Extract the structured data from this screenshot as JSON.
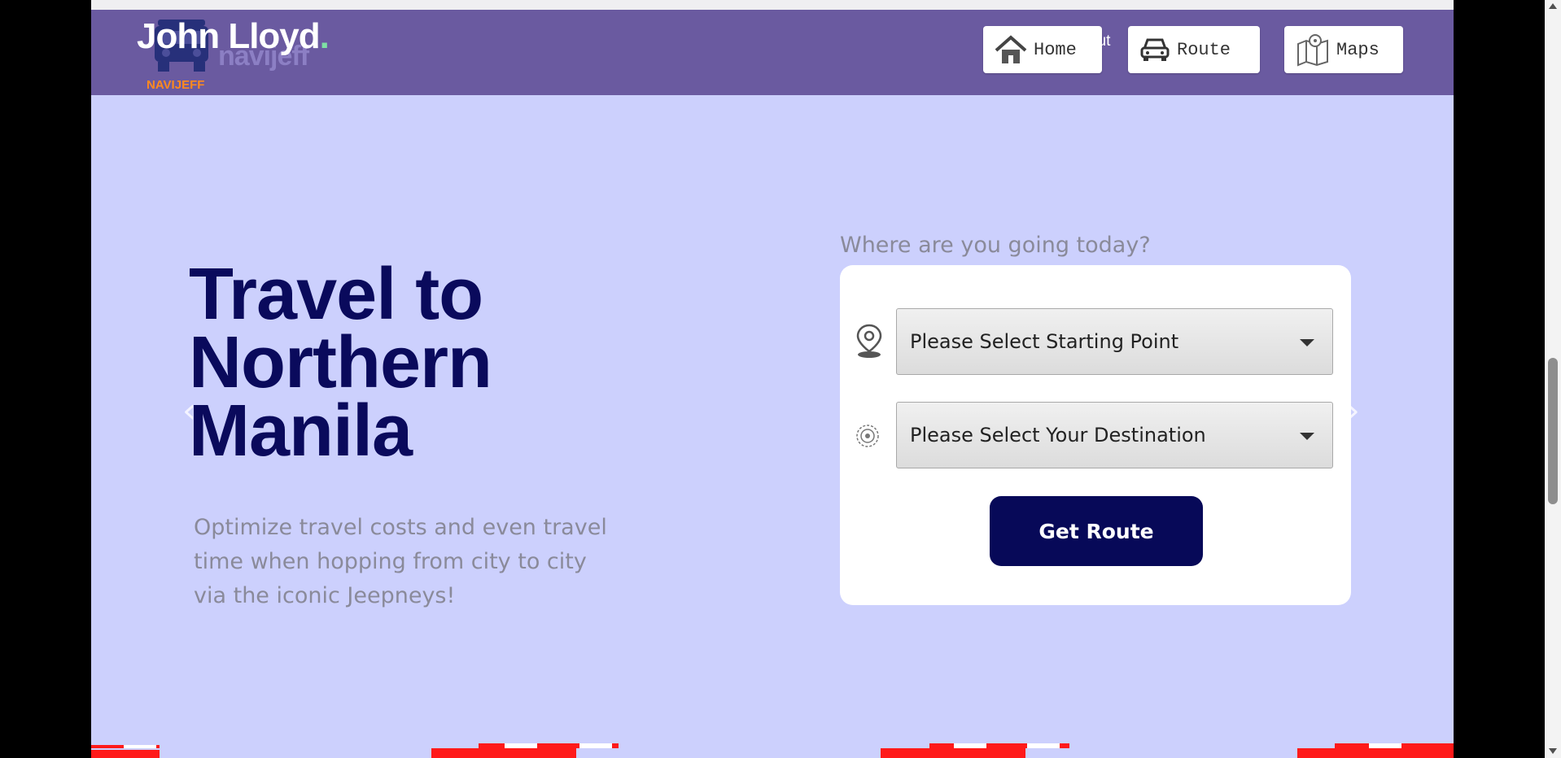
{
  "header": {
    "brand_name": "John Lloyd",
    "brand_dot": ".",
    "logo_faded_text": "navijeff",
    "logo_text": "NAVIJEFF",
    "about_peek": "out",
    "nav": {
      "home_label": "Home",
      "route_label": "Route",
      "maps_label": "Maps"
    }
  },
  "hero": {
    "title_line1": "Travel to",
    "title_line2": "Northern",
    "title_line3": "Manila",
    "subtitle": "Optimize travel costs and even travel time when hopping from city to city via the iconic Jeepneys!"
  },
  "route_form": {
    "caption": "Where are you going today?",
    "start_select": "Please Select Starting Point",
    "destination_select": "Please Select Your Destination",
    "submit_label": "Get Route"
  },
  "carousel": {
    "prev_glyph": "‹",
    "next_glyph": "›"
  },
  "icons": {
    "home": "house-icon",
    "route": "car-icon",
    "maps": "map-icon",
    "start": "location-pin-icon",
    "destination": "target-icon"
  },
  "colors": {
    "navbar": "#6a5aa0",
    "hero_background": "#ccd0fd",
    "title": "#0a0a5c",
    "button": "#070958",
    "brand_dot": "#7ee0a4",
    "logo_text": "#ff8a1e"
  }
}
